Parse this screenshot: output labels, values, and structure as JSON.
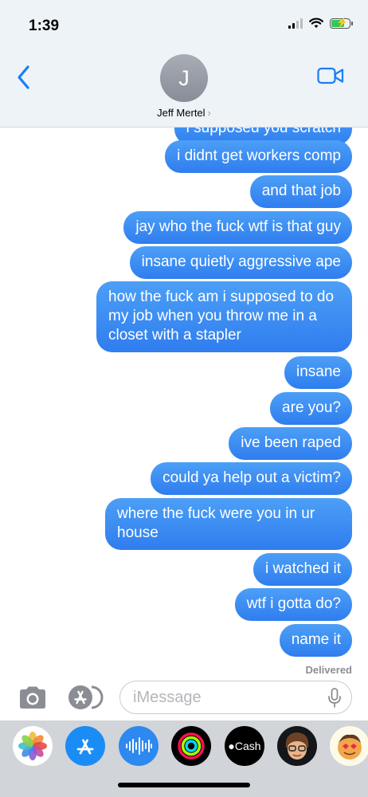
{
  "status_bar": {
    "time": "1:39"
  },
  "header": {
    "avatar_initial": "J",
    "contact_name": "Jeff Mertel",
    "back_icon": "chevron-left-icon",
    "video_icon": "video-camera-icon"
  },
  "messages": [
    {
      "text": "i supposed you scratch"
    },
    {
      "text": "i didnt get workers comp"
    },
    {
      "text": "and that job"
    },
    {
      "text": "jay who the fuck wtf is that guy"
    },
    {
      "text": "insane quietly aggressive ape"
    },
    {
      "text": "how the fuck am i supposed to do my job when you throw me in a closet with a stapler"
    },
    {
      "text": "insane"
    },
    {
      "text": "are you?"
    },
    {
      "text": "ive been raped"
    },
    {
      "text": "could ya help out a victim?"
    },
    {
      "text": "where the fuck were you in ur house"
    },
    {
      "text": "i watched it"
    },
    {
      "text": "wtf i gotta do?"
    },
    {
      "text": "name it"
    }
  ],
  "delivered_label": "Delivered",
  "input": {
    "placeholder": "iMessage",
    "value": ""
  },
  "drawer_apps": [
    {
      "name": "Photos",
      "icon": "photos-icon"
    },
    {
      "name": "App Store",
      "icon": "app-store-icon"
    },
    {
      "name": "Audio",
      "icon": "audio-waveform-icon"
    },
    {
      "name": "Activity",
      "icon": "activity-rings-icon"
    },
    {
      "name": "Cash",
      "label": "Cash",
      "icon": "apple-cash-icon"
    },
    {
      "name": "Memoji",
      "icon": "memoji-icon"
    },
    {
      "name": "Memoji Stickers",
      "icon": "memoji-stickers-icon"
    }
  ],
  "colors": {
    "bubble": "#2f7def",
    "accent": "#1a7ef5",
    "header_bg": "#eef3f8",
    "drawer_bg": "#d1d4d9"
  }
}
